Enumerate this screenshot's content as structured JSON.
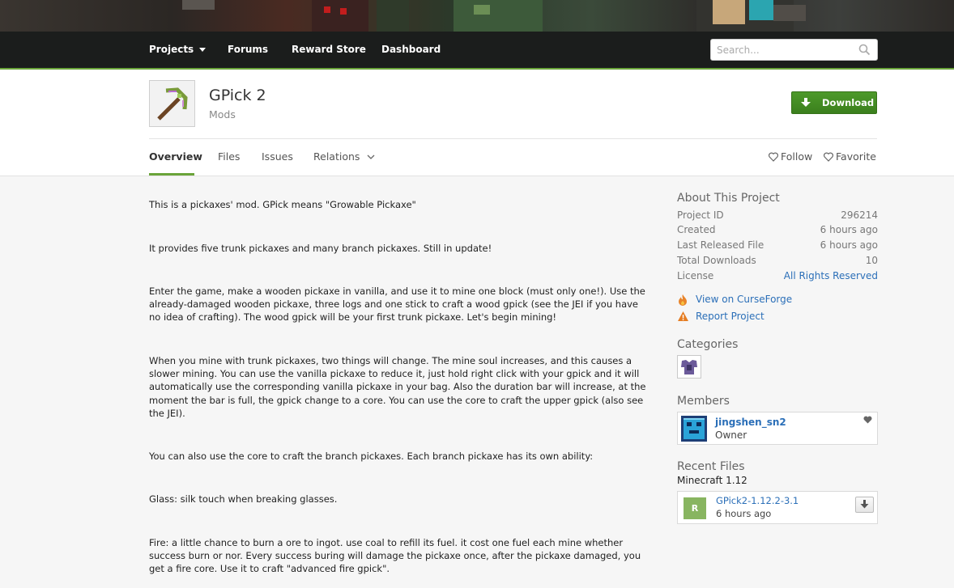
{
  "nav": {
    "projects": "Projects",
    "forums": "Forums",
    "reward_store": "Reward Store",
    "dashboard": "Dashboard",
    "search_placeholder": "Search..."
  },
  "project": {
    "title": "GPick 2",
    "category": "Mods",
    "download_label": "Download"
  },
  "tabs": [
    "Overview",
    "Files",
    "Issues",
    "Relations"
  ],
  "actions": {
    "follow": "Follow",
    "favorite": "Favorite"
  },
  "description": [
    "This is a pickaxes' mod.   GPick means \"Growable Pickaxe\"",
    "It provides five trunk pickaxes and many branch pickaxes. Still in update!",
    "Enter the game, make a wooden pickaxe in vanilla, and use it to mine one block (must only one!). Use the already-damaged wooden pickaxe, three logs and one stick to craft a wood gpick (see the JEI if you have no idea of crafting). The wood gpick will be your first trunk pickaxe. Let's begin mining!",
    "When you mine with trunk pickaxes, two things will change. The mine soul increases, and this causes a slower mining. You can use the vanilla pickaxe to reduce it, just hold right click with your gpick and it will automatically use the corresponding vanilla pickaxe in your bag. Also the duration bar will increase, at the moment the bar is full, the gpick change to a core. You can use the core to craft the upper gpick (also see the JEI).",
    "You can also use the core to craft the branch pickaxes. Each branch pickaxe has its own ability:",
    "Glass:  silk touch when breaking glasses.",
    "Fire: a little chance to burn a ore to ingot. use coal to refill its fuel. it cost one fuel each mine whether success burn or nor. Every success buring will damage the pickaxe once, after the pickaxe damaged, you get a fire core. Use it to craft \"advanced fire gpick\"."
  ],
  "about": {
    "heading": "About This Project",
    "rows": [
      {
        "label": "Project ID",
        "value": "296214"
      },
      {
        "label": "Created",
        "value": "6 hours ago"
      },
      {
        "label": "Last Released File",
        "value": "6 hours ago"
      },
      {
        "label": "Total Downloads",
        "value": "10"
      },
      {
        "label": "License",
        "value": "All Rights Reserved"
      }
    ],
    "view_on": "View on CurseForge",
    "report": "Report Project"
  },
  "categories": {
    "heading": "Categories",
    "icon": "armor-category-icon"
  },
  "members": {
    "heading": "Members",
    "name": "jingshen_sn2",
    "role": "Owner"
  },
  "recent_files": {
    "heading": "Recent Files",
    "version": "Minecraft 1.12",
    "release_type": "R",
    "file_name": "GPick2-1.12.2-3.1",
    "file_time": "6 hours ago"
  },
  "colors": {
    "accent_green": "#6aa43a",
    "download_green": "#3f8a20",
    "link_blue": "#2b6fb8",
    "nav_bg": "#1b1d1c"
  }
}
